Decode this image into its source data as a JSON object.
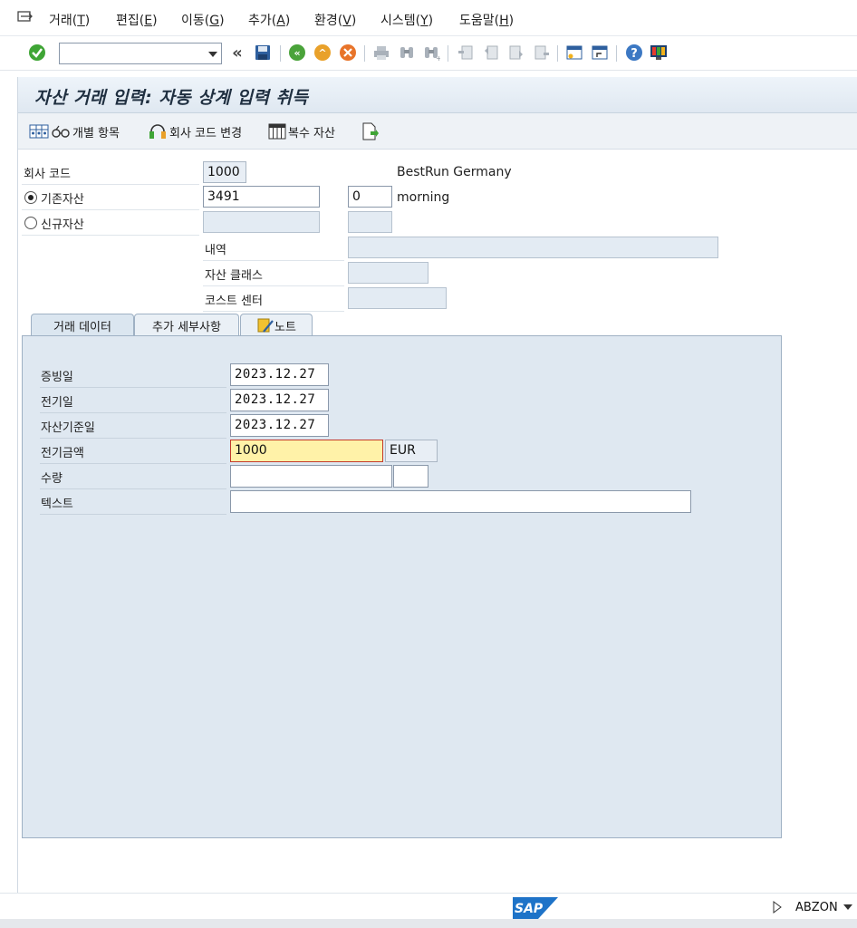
{
  "menu": {
    "items": [
      {
        "label": "거래(",
        "key": "T",
        "suffix": ")"
      },
      {
        "label": "편집(",
        "key": "E",
        "suffix": ")"
      },
      {
        "label": "이동(",
        "key": "G",
        "suffix": ")"
      },
      {
        "label": "추가(",
        "key": "A",
        "suffix": ")"
      },
      {
        "label": "환경(",
        "key": "V",
        "suffix": ")"
      },
      {
        "label": "시스템(",
        "key": "Y",
        "suffix": ")"
      },
      {
        "label": "도움말(",
        "key": "H",
        "suffix": ")"
      }
    ]
  },
  "toolbar": {
    "command_value": "",
    "icons": [
      "enter-icon",
      "save-icon",
      "back-icon",
      "exit-icon",
      "cancel-icon",
      "print-icon",
      "find-icon",
      "find-next-icon",
      "first-page-icon",
      "previous-page-icon",
      "next-page-icon",
      "last-page-icon",
      "new-session-icon",
      "shortcut-icon",
      "help-icon",
      "customize-layout-icon"
    ]
  },
  "title": "자산 거래 입력: 자동 상계 입력 취득",
  "app_toolbar": {
    "multiple_items_label": "개별 항목",
    "change_company_label": "회사 코드 변경",
    "multiple_assets_label": "복수 자산"
  },
  "header": {
    "company_code_label": "회사 코드",
    "company_code_value": "1000",
    "company_name": "BestRun Germany",
    "existing_asset_label": "기존자산",
    "existing_asset_value": "3491",
    "subnumber_value": "0",
    "asset_description": "morning",
    "new_asset_label": "신규자산",
    "description_label": "내역",
    "asset_class_label": "자산 클래스",
    "cost_center_label": "코스트 센터"
  },
  "tabs": [
    {
      "label": "거래 데이터",
      "active": true
    },
    {
      "label": "추가 세부사항",
      "active": false
    },
    {
      "label": "노트",
      "active": false
    }
  ],
  "transaction": {
    "document_date_label": "증빙일",
    "document_date_value": "2023.12.27",
    "posting_date_label": "전기일",
    "posting_date_value": "2023.12.27",
    "value_date_label": "자산기준일",
    "value_date_value": "2023.12.27",
    "amount_label": "전기금액",
    "amount_value": "1000",
    "currency_value": "EUR",
    "quantity_label": "수량",
    "quantity_value": "",
    "unit_value": "",
    "text_label": "텍스트",
    "text_value": ""
  },
  "status": {
    "logo": "SAP",
    "system_id": "ABZON"
  },
  "colors": {
    "highlight_field": "#fff2a8",
    "panel_background": "#dfe8f1",
    "title_text": "#1f2f40"
  }
}
